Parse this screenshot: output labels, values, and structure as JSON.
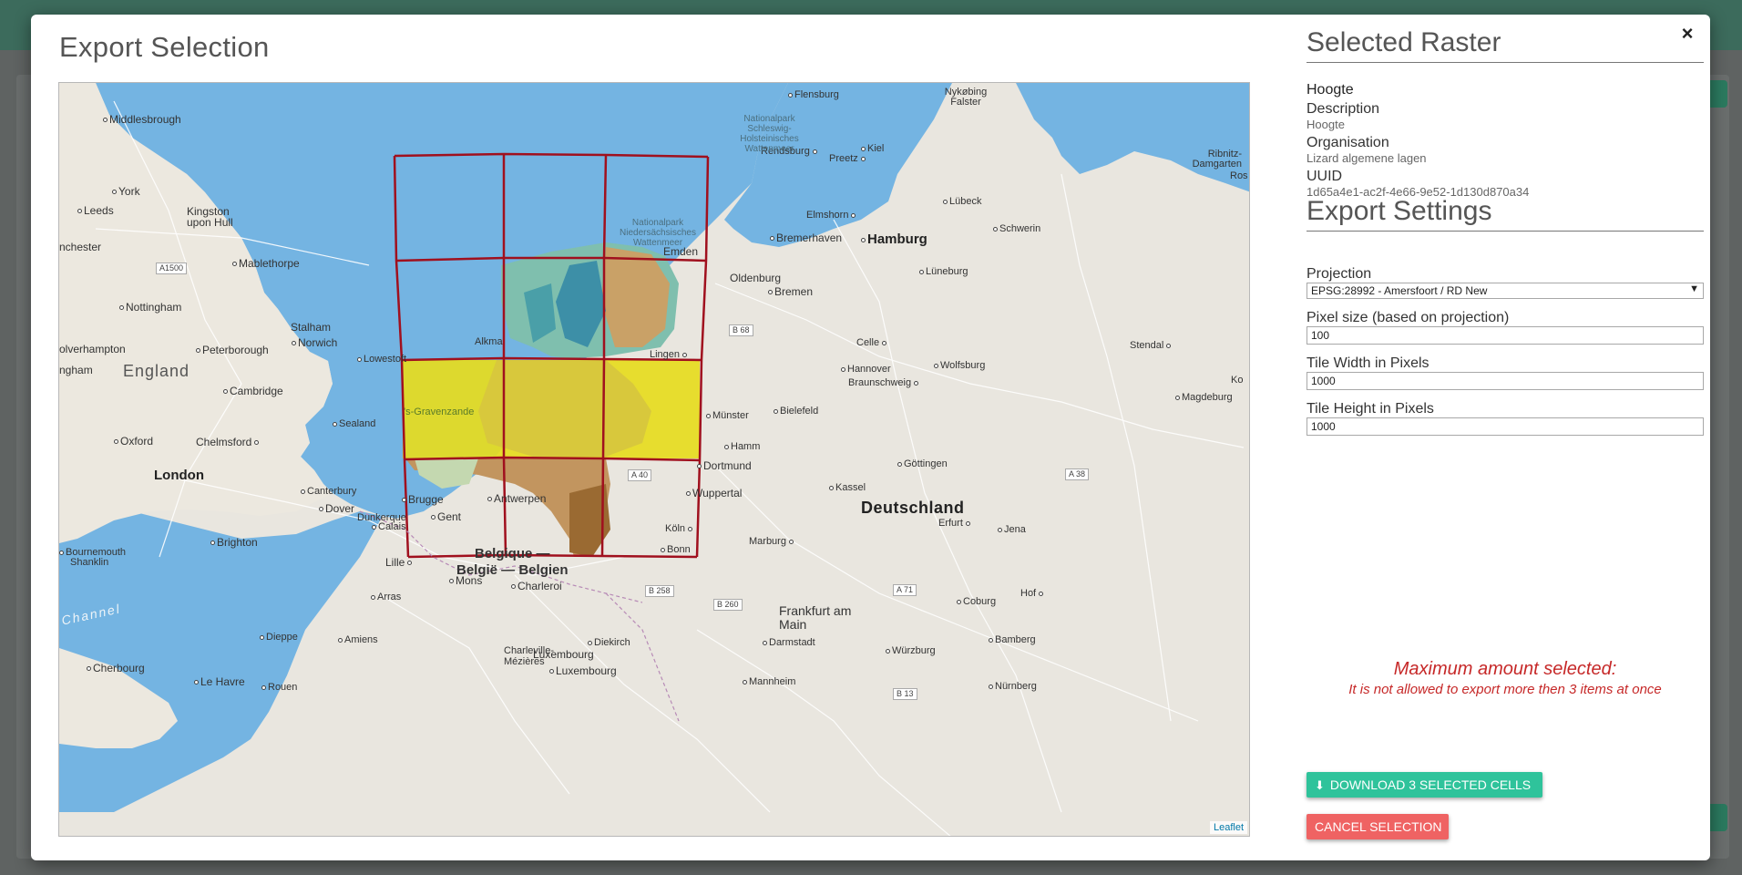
{
  "modal": {
    "title": "Export Selection",
    "close_label": "×"
  },
  "map": {
    "attribution": "Leaflet",
    "labels": {
      "middlesbrough": "Middlesbrough",
      "york": "York",
      "leeds": "Leeds",
      "kingston": "Kingston upon Hull",
      "manchester": "nchester",
      "a1500": "A1500",
      "mablethorpe": "Mablethorpe",
      "nottingham": "Nottingham",
      "stalham": "Stalham",
      "norwich": "Norwich",
      "wolverhampton": "olverhampton",
      "peterborough": "Peterborough",
      "lowestoft": "Lowestoft",
      "birmingham": "ngham",
      "england": "England",
      "cambridge": "Cambridge",
      "sealand": "Sealand",
      "oxford": "Oxford",
      "chelmsford": "Chelmsford",
      "london": "London",
      "canterbury": "Canterbury",
      "dover": "Dover",
      "dunkerque": "Dunkerque",
      "calais": "Calais",
      "brighton": "Brighton",
      "bournemouth": "Bournemouth",
      "shanklin": "Shanklin",
      "channel": "Channel",
      "cherbourg": "Cherbourg",
      "lehavre": "Le Havre",
      "rouen": "Rouen",
      "dieppe": "Dieppe",
      "amiens": "Amiens",
      "arras": "Arras",
      "lille": "Lille",
      "brugge": "Brugge",
      "gent": "Gent",
      "antwerpen": "Antwerpen",
      "belgique": "Belgique —",
      "belgie": "België — Belgien",
      "mons": "Mons",
      "charleroi": "Charleroi",
      "charleville": "Charleville-Mézières",
      "luxembourg1": "Luxembourg",
      "luxembourg2": "Luxembourg",
      "diekirch": "Diekirch",
      "flensburg": "Flensburg",
      "nykobing": "Nykøbing Falster",
      "kiel": "Kiel",
      "preetz": "Preetz",
      "rendsburg": "Rendsburg",
      "ribnitz": "Ribnitz-Damgarten",
      "rostock": "Ros",
      "luebeck": "Lübeck",
      "elmshorn": "Elmshorn",
      "schwerin": "Schwerin",
      "bremerhaven": "Bremerhaven",
      "hamburg": "Hamburg",
      "emden": "Emden",
      "oldenburg": "Oldenburg",
      "bremen": "Bremen",
      "lueneburg": "Lüneburg",
      "celle": "Celle",
      "stendal": "Stendal",
      "hannover": "Hannover",
      "wolfsburg": "Wolfsburg",
      "braunschweig": "Braunschweig",
      "magdeburg": "Magdeburg",
      "ko": "Ko",
      "bielefeld": "Bielefeld",
      "muenster": "Münster",
      "hamm": "Hamm",
      "dortmund": "Dortmund",
      "goettingen": "Göttingen",
      "a38": "A 38",
      "kassel": "Kassel",
      "wuppertal": "Wuppertal",
      "a40": "A 40",
      "deutschland": "Deutschland",
      "erfurt": "Erfurt",
      "jena": "Jena",
      "koeln": "Köln",
      "bonn": "Bonn",
      "marburg": "Marburg",
      "a71": "A 71",
      "hof": "Hof",
      "coburg": "Coburg",
      "frankfurt": "Frankfurt am Main",
      "b260": "B 260",
      "b258": "B 258",
      "darmstadt": "Darmstadt",
      "bamberg": "Bamberg",
      "wuerzburg": "Würzburg",
      "mannheim": "Mannheim",
      "nuernberg": "Nürnberg",
      "b13": "B 13",
      "b68": "B 68",
      "lingen": "Lingen",
      "alkmaar": "Alkma",
      "sgravenzande": "'s-Gravenzande",
      "np_sh": "Nationalpark Schleswig-Holsteinisches Wattenmeer",
      "np_nds": "Nationalpark Niedersächsisches Wattenmeer"
    }
  },
  "raster": {
    "heading": "Selected Raster",
    "name": "Hoogte",
    "description_label": "Description",
    "description_value": "Hoogte",
    "organisation_label": "Organisation",
    "organisation_value": "Lizard algemene lagen",
    "uuid_label": "UUID",
    "uuid_value": "1d65a4e1-ac2f-4e66-9e52-1d130d870a34"
  },
  "settings": {
    "heading": "Export Settings",
    "projection_label": "Projection",
    "projection_value": "EPSG:28992 - Amersfoort / RD New",
    "pixel_size_label": "Pixel size (based on projection)",
    "pixel_size_value": "100",
    "tile_width_label": "Tile Width in Pixels",
    "tile_width_value": "1000",
    "tile_height_label": "Tile Height in Pixels",
    "tile_height_value": "1000"
  },
  "warning": {
    "title": "Maximum amount selected:",
    "text": "It is not allowed to export more then 3 items at once"
  },
  "buttons": {
    "download_label": "DOWNLOAD 3 SELECTED CELLS",
    "cancel_label": "CANCEL SELECTION"
  },
  "colors": {
    "grid_line": "#a0101e",
    "selected_fill": "#e6dc1e",
    "sea": "#74b4e2",
    "land": "#e9e6df",
    "download_button": "#2fc39b",
    "cancel_button": "#ef6363",
    "warning": "#c62828"
  },
  "icons": {
    "download": "download-icon",
    "close": "close-icon",
    "select_arrow": "chevron-down-icon"
  }
}
